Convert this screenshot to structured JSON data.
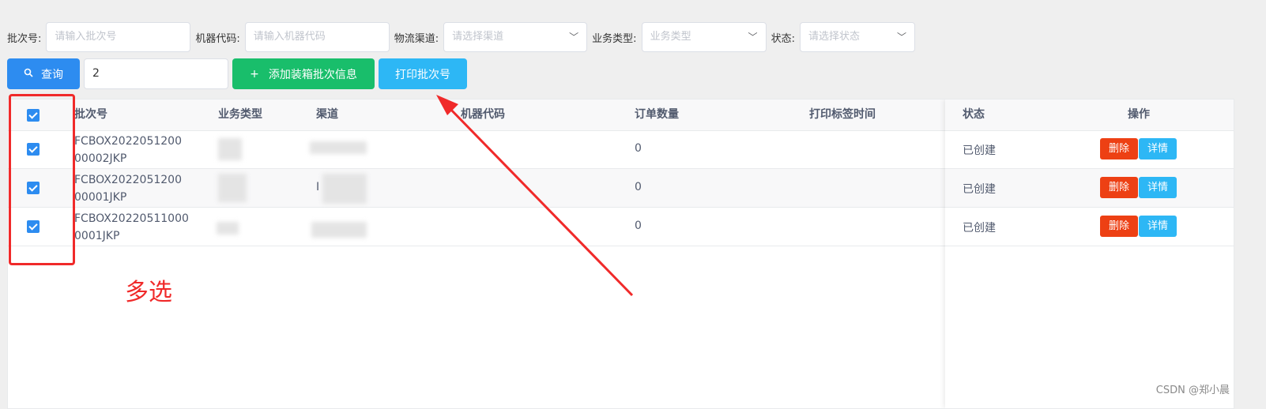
{
  "filters": {
    "batch_label": "批次号:",
    "batch_placeholder": "请输入批次号",
    "machine_label": "机器代码:",
    "machine_placeholder": "请输入机器代码",
    "channel_label": "物流渠道:",
    "channel_placeholder": "请选择渠道",
    "biztype_label": "业务类型:",
    "biztype_placeholder": "业务类型",
    "status_label": "状态:",
    "status_placeholder": "请选择状态"
  },
  "actions": {
    "query": "查询",
    "page_input_value": "2",
    "add": "添加装箱批次信息",
    "print": "打印批次号"
  },
  "table": {
    "columns": [
      "批次号",
      "业务类型",
      "渠道",
      "机器代码",
      "订单数量",
      "打印标签时间",
      "状态",
      "操作"
    ],
    "rows": [
      {
        "batch_line1": "FCBOX2022051200",
        "batch_line2": "00002JKP",
        "orders": "0",
        "status": "已创建",
        "channel_frag": ""
      },
      {
        "batch_line1": "FCBOX2022051200",
        "batch_line2": "00001JKP",
        "orders": "0",
        "status": "已创建",
        "channel_frag": "I"
      },
      {
        "batch_line1": "FCBOX20220511000",
        "batch_line2": "0001JKP",
        "orders": "0",
        "status": "已创建",
        "channel_frag": ""
      }
    ],
    "delete_label": "删除",
    "detail_label": "详情"
  },
  "annotation": {
    "text": "多选"
  },
  "watermark": "CSDN @郑小晨",
  "icons": {
    "search": "search-icon",
    "plus": "plus-icon",
    "chevron": "chevron-down-icon"
  },
  "colors": {
    "primary": "#2d8cf0",
    "success": "#19be6b",
    "info": "#2db7f5",
    "danger": "#ed4014",
    "annotation": "#f02a2a"
  }
}
